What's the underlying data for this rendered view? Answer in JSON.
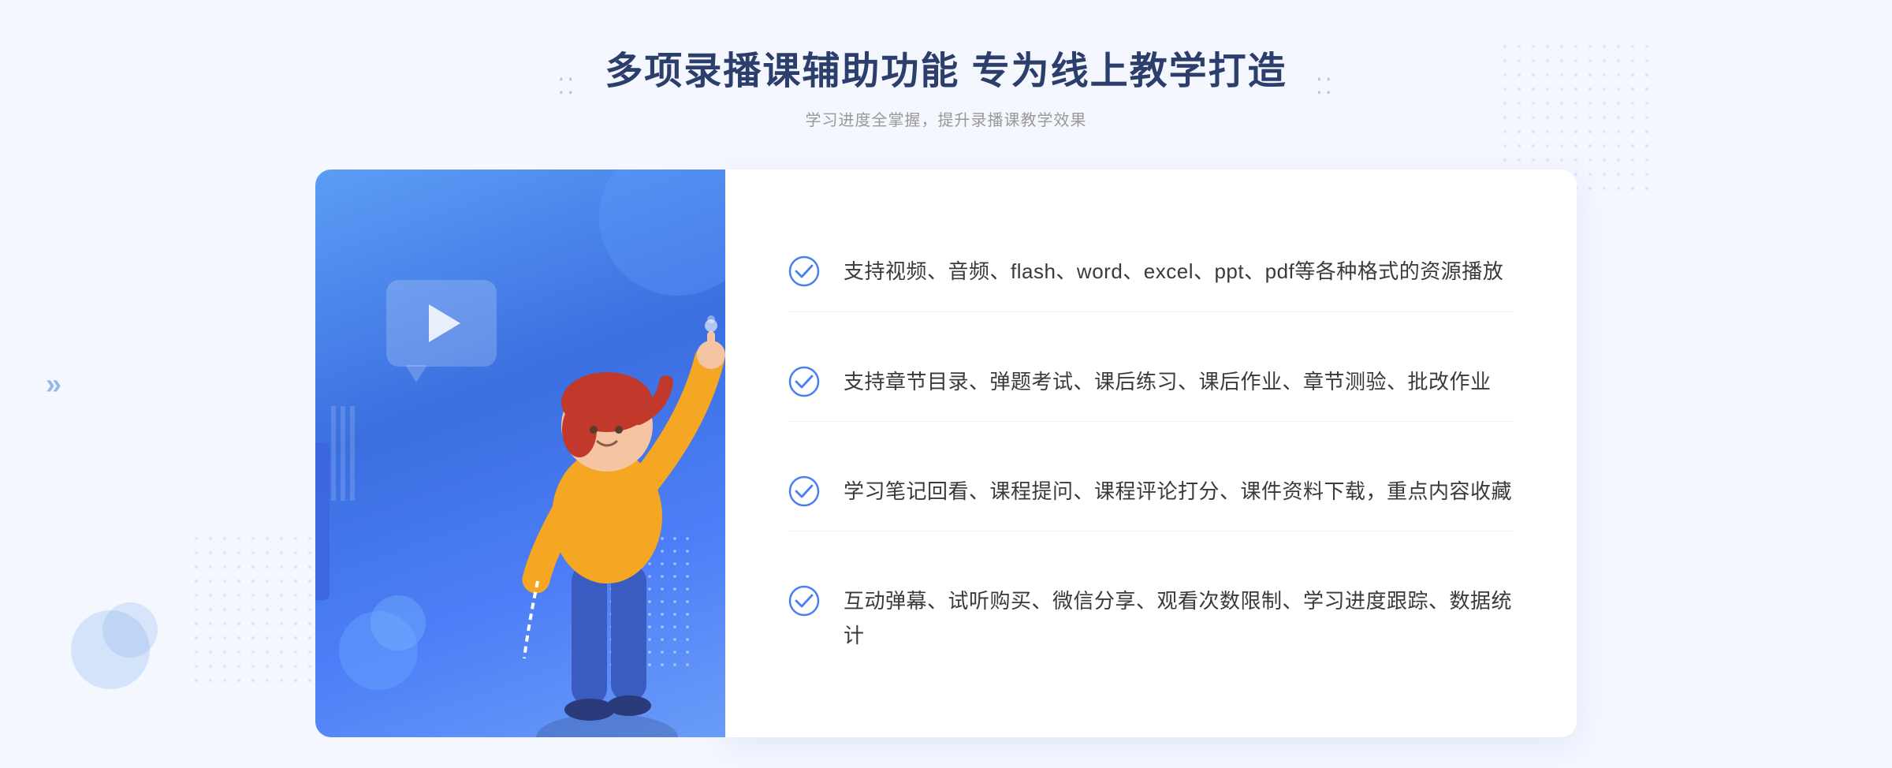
{
  "header": {
    "main_title": "多项录播课辅助功能 专为线上教学打造",
    "sub_title": "学习进度全掌握，提升录播课教学效果"
  },
  "features": [
    {
      "id": "feature-1",
      "text": "支持视频、音频、flash、word、excel、ppt、pdf等各种格式的资源播放"
    },
    {
      "id": "feature-2",
      "text": "支持章节目录、弹题考试、课后练习、课后作业、章节测验、批改作业"
    },
    {
      "id": "feature-3",
      "text": "学习笔记回看、课程提问、课程评论打分、课件资料下载，重点内容收藏"
    },
    {
      "id": "feature-4",
      "text": "互动弹幕、试听购买、微信分享、观看次数限制、学习进度跟踪、数据统计"
    }
  ],
  "colors": {
    "primary_blue": "#4a7ef5",
    "dark_blue": "#2c3e6b",
    "check_color": "#4a7ef5",
    "text_color": "#3a3a3a",
    "subtitle_color": "#999999",
    "bg_color": "#f5f7ff"
  },
  "decorations": {
    "chevron": "»",
    "dots_icon": "⁚⁚"
  }
}
